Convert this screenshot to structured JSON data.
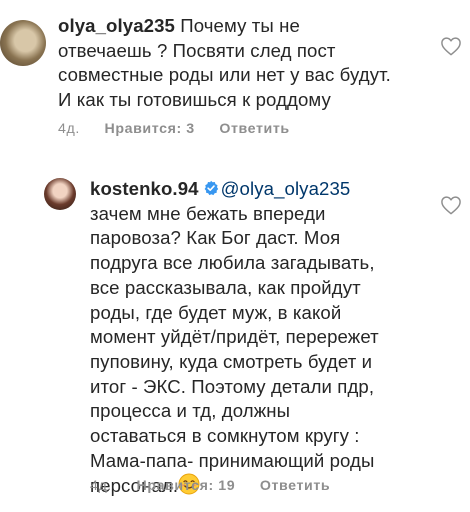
{
  "comments": [
    {
      "username": "olya_olya235",
      "text": " Почему ты не\nотвечаешь ? Посвяти след пост\nсовместные роды или нет у вас будут.\nИ как ты готовишься к роддому",
      "age": "4д.",
      "likes": "Нравится: 3",
      "reply": "Ответить"
    },
    {
      "username": "kostenko.94",
      "verified": true,
      "mention": "@olya_olya235",
      "text": "зачем мне бежать впереди\nпаровоза? Как Бог даст. Моя\nподруга все любила загадывать,\nвсе рассказывала, как пройдут\nроды, где будет муж, в какой\nмомент уйдёт/придёт, перережет\nпуповину, куда смотреть будет  и\nитог - ЭКС.  Поэтому детали пдр,\nпроцесса и тд, должны\nоставаться в сомкнутом кругу :\nМама-папа- принимающий роды\nперсонал.",
      "age": "4д.",
      "likes": "Нравится: 19",
      "reply": "Ответить"
    }
  ],
  "icons": {
    "heart": "heart-outline-icon",
    "verified": "verified-badge-icon",
    "emoji": "smiling-face-emoji"
  },
  "colors": {
    "text": "#262626",
    "meta": "#8e8e8e",
    "mention": "#00376b",
    "verified": "#3897f0"
  }
}
